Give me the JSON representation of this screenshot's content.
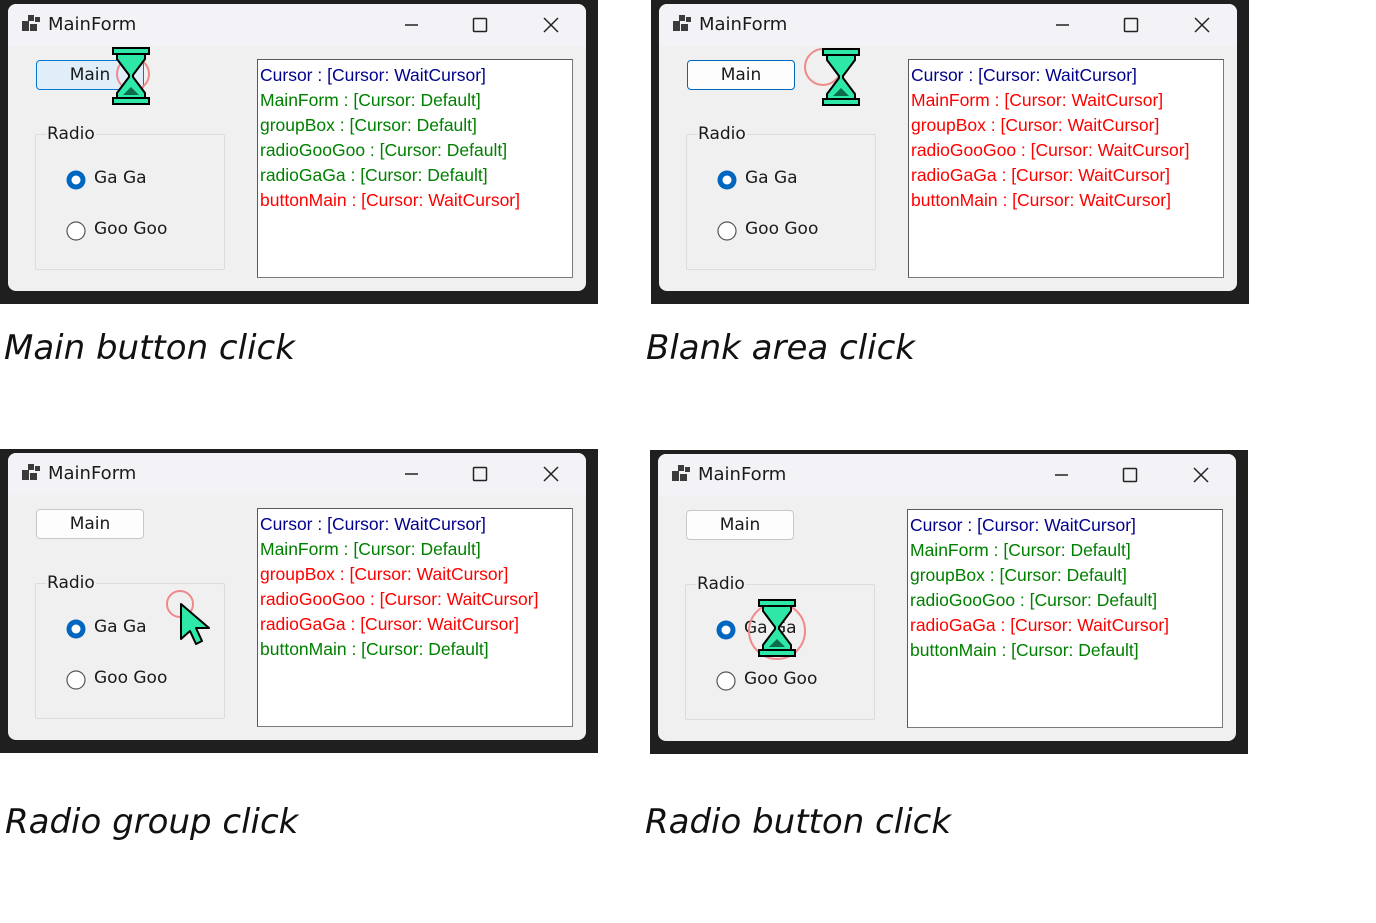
{
  "panels": [
    {
      "caption": "Main button click",
      "window_title": "MainForm",
      "main_button": "Main",
      "group_label": "Radio",
      "radio_1": "Ga Ga",
      "radio_2": "Goo Goo",
      "cursor": "hourglass-wait-cursor",
      "log": [
        {
          "text": "Cursor : [Cursor: WaitCursor]",
          "color": "#00008b"
        },
        {
          "text": "MainForm : [Cursor: Default]",
          "color": "#008000"
        },
        {
          "text": "groupBox : [Cursor: Default]",
          "color": "#008000"
        },
        {
          "text": "radioGooGoo : [Cursor: Default]",
          "color": "#008000"
        },
        {
          "text": "radioGaGa : [Cursor: Default]",
          "color": "#008000"
        },
        {
          "text": "buttonMain : [Cursor: WaitCursor]",
          "color": "#ff0000"
        }
      ]
    },
    {
      "caption": "Blank area click",
      "window_title": "MainForm",
      "main_button": "Main",
      "group_label": "Radio",
      "radio_1": "Ga Ga",
      "radio_2": "Goo Goo",
      "cursor": "hourglass-wait-cursor",
      "log": [
        {
          "text": "Cursor : [Cursor: WaitCursor]",
          "color": "#00008b"
        },
        {
          "text": "MainForm : [Cursor: WaitCursor]",
          "color": "#ff0000"
        },
        {
          "text": "groupBox : [Cursor: WaitCursor]",
          "color": "#ff0000"
        },
        {
          "text": "radioGooGoo : [Cursor: WaitCursor]",
          "color": "#ff0000"
        },
        {
          "text": "radioGaGa : [Cursor: WaitCursor]",
          "color": "#ff0000"
        },
        {
          "text": "buttonMain : [Cursor: WaitCursor]",
          "color": "#ff0000"
        }
      ]
    },
    {
      "caption": "Radio group click",
      "window_title": "MainForm",
      "main_button": "Main",
      "group_label": "Radio",
      "radio_1": "Ga Ga",
      "radio_2": "Goo Goo",
      "cursor": "arrow-cursor",
      "log": [
        {
          "text": "Cursor : [Cursor: WaitCursor]",
          "color": "#00008b"
        },
        {
          "text": "MainForm : [Cursor: Default]",
          "color": "#008000"
        },
        {
          "text": "groupBox : [Cursor: WaitCursor]",
          "color": "#ff0000"
        },
        {
          "text": "radioGooGoo : [Cursor: WaitCursor]",
          "color": "#ff0000"
        },
        {
          "text": "radioGaGa : [Cursor: WaitCursor]",
          "color": "#ff0000"
        },
        {
          "text": "buttonMain : [Cursor: Default]",
          "color": "#008000"
        }
      ]
    },
    {
      "caption": "Radio button click",
      "window_title": "MainForm",
      "main_button": "Main",
      "group_label": "Radio",
      "radio_1": "Ga Ga",
      "radio_2": "Goo Goo",
      "cursor": "hourglass-wait-cursor",
      "log": [
        {
          "text": "Cursor : [Cursor: WaitCursor]",
          "color": "#00008b"
        },
        {
          "text": "MainForm : [Cursor: Default]",
          "color": "#008000"
        },
        {
          "text": "groupBox : [Cursor: Default]",
          "color": "#008000"
        },
        {
          "text": "radioGooGoo : [Cursor: Default]",
          "color": "#008000"
        },
        {
          "text": "radioGaGa : [Cursor: WaitCursor]",
          "color": "#ff0000"
        },
        {
          "text": "buttonMain : [Cursor: Default]",
          "color": "#008000"
        }
      ]
    }
  ],
  "colors": {
    "accent": "#0067c0",
    "default_log": "#008000",
    "wait_log": "#ff0000",
    "cursor_log": "#00008b",
    "cursor_fill": "#2ee8a8",
    "panel_border": "#1f1f1f"
  }
}
